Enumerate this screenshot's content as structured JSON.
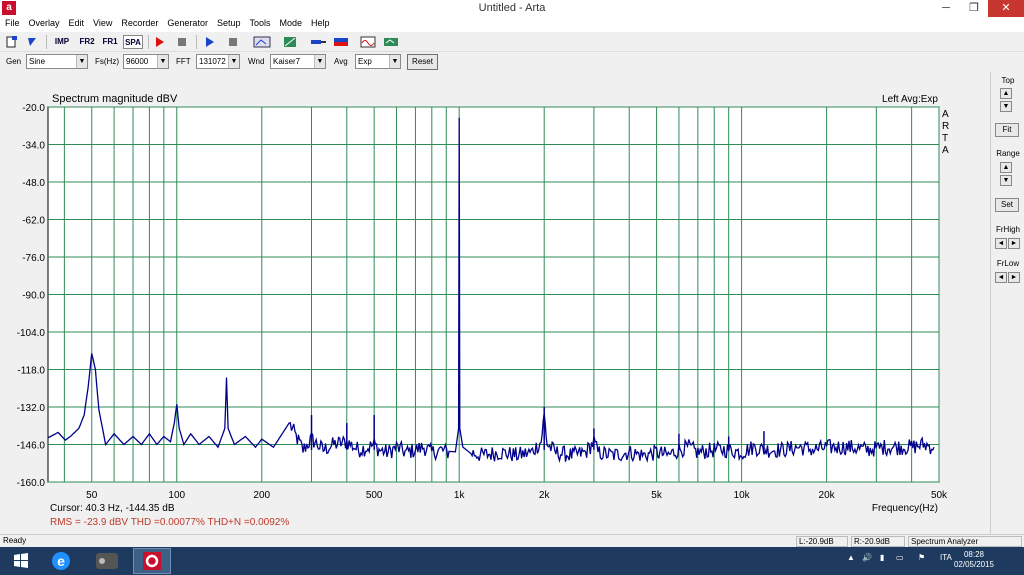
{
  "window": {
    "title": "Untitled - Arta",
    "app_icon": "arta-logo-icon",
    "minimize": "─",
    "maximize": "❐",
    "close": "✕"
  },
  "menu": [
    "File",
    "Overlay",
    "Edit",
    "View",
    "Recorder",
    "Generator",
    "Setup",
    "Tools",
    "Mode",
    "Help"
  ],
  "toolbar": {
    "imp": "IMP",
    "fr2": "FR2",
    "fr1": "FR1",
    "spa": "SPA"
  },
  "controls": {
    "gen_label": "Gen",
    "gen_value": "Sine",
    "fs_label": "Fs(Hz)",
    "fs_value": "96000",
    "fft_label": "FFT",
    "fft_value": "131072",
    "wnd_label": "Wnd",
    "wnd_value": "Kaiser7",
    "avg_label": "Avg",
    "avg_value": "Exp",
    "reset": "Reset"
  },
  "right_panel": {
    "top": "Top",
    "fit": "Fit",
    "range": "Range",
    "set": "Set",
    "frhigh": "FrHigh",
    "frlow": "FrLow"
  },
  "chart_data": {
    "type": "line",
    "title": "Spectrum magnitude dBV",
    "top_right_label": "Left  Avg:Exp",
    "watermark": "ARTA",
    "xlabel": "Frequency(Hz)",
    "x_scale": "log",
    "xlim": [
      35,
      50000
    ],
    "ylim": [
      -160,
      -20
    ],
    "y_ticks": [
      "-20.0",
      "-34.0",
      "-48.0",
      "-62.0",
      "-76.0",
      "-90.0",
      "-104.0",
      "-118.0",
      "-132.0",
      "-146.0",
      "-160.0"
    ],
    "x_ticks": [
      "50",
      "100",
      "200",
      "500",
      "1k",
      "2k",
      "5k",
      "10k",
      "20k",
      "50k"
    ],
    "grid": true,
    "colors": {
      "trace": "#00008b",
      "grid": "#2e8b57",
      "background": "#ffffff"
    },
    "series": [
      {
        "x": [
          35,
          38,
          40.3,
          42,
          45,
          47,
          48.5,
          50,
          51.5,
          53,
          56,
          60,
          65,
          70,
          75,
          80,
          85,
          90,
          95,
          98,
          100,
          102,
          106,
          112,
          120,
          130,
          140,
          148,
          150,
          152,
          160,
          175,
          190,
          200,
          220,
          250,
          280,
          300,
          330,
          360,
          400,
          440,
          480,
          500,
          520,
          560,
          600,
          650,
          700,
          750,
          800,
          860,
          920,
          970,
          995,
          1000,
          1005,
          1030,
          1100,
          1200,
          1400,
          1600,
          1800,
          1950,
          2000,
          2050,
          2200,
          2500,
          2800,
          3000,
          3100,
          3500,
          4000,
          4500,
          5000,
          5500,
          6000,
          6500,
          7000,
          8000,
          9000,
          10000,
          11000,
          12000,
          14000,
          16000,
          18000,
          20000,
          24000,
          28000,
          32000,
          36000,
          40000,
          44000,
          48000
        ],
        "y": [
          -143.5,
          -141.5,
          -144.35,
          -143,
          -140,
          -135,
          -125,
          -112,
          -118,
          -133,
          -146,
          -142,
          -146,
          -143,
          -146,
          -142,
          -146,
          -143,
          -145,
          -138,
          -131,
          -140,
          -146,
          -142,
          -146,
          -143,
          -147,
          -140,
          -121,
          -140,
          -146,
          -143,
          -147,
          -144,
          -147,
          -138,
          -148,
          -144,
          -148,
          -146,
          -145,
          -148,
          -147,
          -146,
          -148,
          -149,
          -147,
          -149,
          -148,
          -147,
          -149,
          -148,
          -149,
          -147,
          -140,
          -24,
          -140,
          -148,
          -149,
          -150,
          -149,
          -150,
          -149,
          -145,
          -135,
          -146,
          -149,
          -150,
          -149,
          -145,
          -149,
          -150,
          -149,
          -150,
          -149,
          -150,
          -148,
          -147,
          -149,
          -148,
          -148,
          -149,
          -147,
          -148,
          -148,
          -147,
          -148,
          -147,
          -147,
          -148,
          -147,
          -147,
          -147,
          -146,
          -147
        ],
        "spikes": [
          {
            "freq": 300,
            "top": -135
          },
          {
            "freq": 400,
            "top": -138
          },
          {
            "freq": 500,
            "top": -135
          },
          {
            "freq": 2000,
            "top": -132
          },
          {
            "freq": 3000,
            "top": -140
          },
          {
            "freq": 6000,
            "top": -142
          },
          {
            "freq": 9000,
            "top": -143
          },
          {
            "freq": 12000,
            "top": -141
          }
        ]
      }
    ]
  },
  "cursor_readout": "Cursor:   40.3 Hz, -144.35 dB",
  "measurements": "RMS =  -23.9 dBV   THD =0.00077%   THD+N =0.0092%",
  "status": {
    "ready": "Ready",
    "l": "L:-20.9dB",
    "r": "R:-20.9dB",
    "mode": "Spectrum Analyzer"
  },
  "taskbar": {
    "lang": "ITA",
    "time": "08:28",
    "date": "02/05/2015"
  }
}
